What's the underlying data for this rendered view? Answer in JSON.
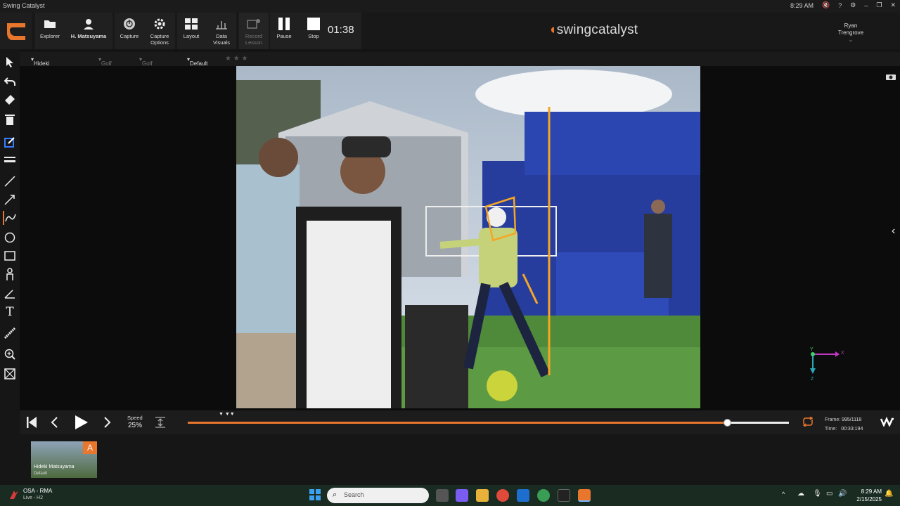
{
  "window": {
    "title": "Swing Catalyst",
    "clock": "8:29 AM"
  },
  "toolbar": {
    "explorer": "Explorer",
    "athlete": "H. Matsuyama",
    "capture": "Capture",
    "capture_options": "Capture Options",
    "layout": "Layout",
    "data_visuals": "Data Visuals",
    "record_lesson": "Record Lesson",
    "pause": "Pause",
    "stop": "Stop",
    "timer": "01:38"
  },
  "brand": {
    "prefix": "swing",
    "suffix": "catalyst"
  },
  "user": {
    "first": "Ryan",
    "last": "Trengrove"
  },
  "breadcrumb": {
    "athlete": "Hideki Matsuyama",
    "sport": "Golf",
    "activity": "Golf Swing",
    "layout": "Default"
  },
  "axes": {
    "y": "Y",
    "x": "X",
    "z": "Z"
  },
  "player": {
    "speed_label": "Speed",
    "speed_value": "25%",
    "progress": 0.898,
    "frame_label": "Frame:",
    "frame_value": "995/1118",
    "time_label": "Time:",
    "time_value": "00:33:194"
  },
  "thumbnail": {
    "badge": "A",
    "name": "Hideki Matsuyama",
    "sub": "Default"
  },
  "taskbar": {
    "app_name": "OSA - RMA",
    "app_sub": "Live - H2",
    "search_placeholder": "Search",
    "time": "8:29 AM",
    "date": "2/15/2025"
  },
  "colors": {
    "accent": "#e8762c",
    "annotation": "#f5a623"
  }
}
